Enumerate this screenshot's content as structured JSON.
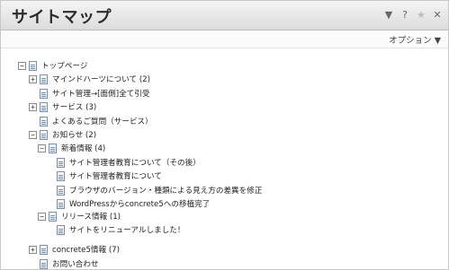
{
  "window": {
    "title": "サイトマップ",
    "controls": [
      "▼",
      "?",
      "★",
      "✕"
    ]
  },
  "options_label": "オプション ▼",
  "tree": {
    "root": "トップページ",
    "mind": "マインドハーツについて (2)",
    "admin": "サイト管理→[面側]全て引受",
    "service": "サービス (3)",
    "faq": "よくあるご質問（サービス）",
    "news": "お知らせ (2)",
    "new_info": "新着情報 (4)",
    "n1": "サイト管理者教育について（その後）",
    "n2": "サイト管理者教育について",
    "n3": "ブラウザのバージョン・種類による見え方の差異を修正",
    "n4": "WordPressからconcrete5への移植完了",
    "release": "リリース情報 (1)",
    "r1": "サイトをリニューアルしました！",
    "c5": "concrete5情報 (7)",
    "contact": "お問い合わせ"
  }
}
